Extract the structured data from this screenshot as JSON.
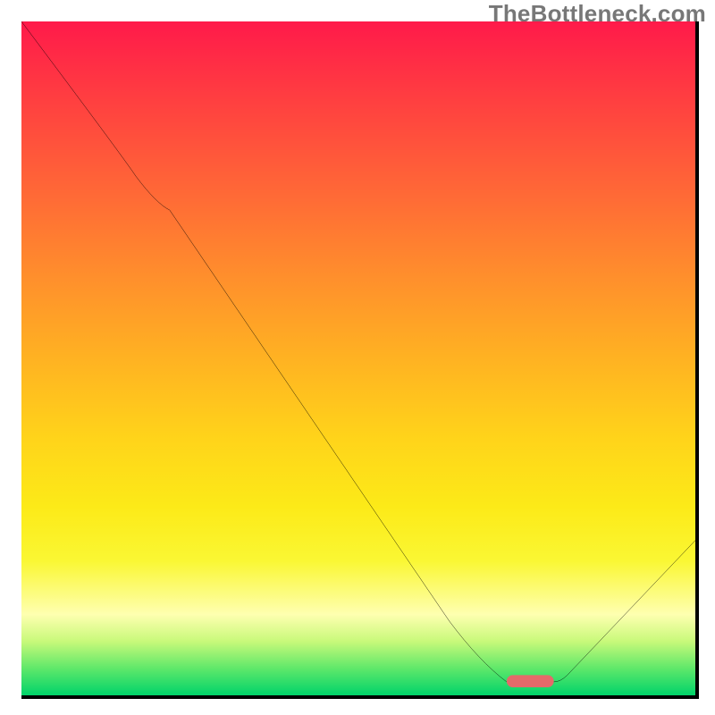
{
  "watermark": "TheBottleneck.com",
  "chart_data": {
    "type": "line",
    "title": "",
    "xlabel": "",
    "ylabel": "",
    "xlim": [
      0,
      100
    ],
    "ylim": [
      0,
      100
    ],
    "grid": false,
    "legend": false,
    "background": "red-yellow-green vertical gradient",
    "series": [
      {
        "name": "curve",
        "x": [
          0,
          17,
          22,
          63.5,
          72,
          79,
          81,
          100
        ],
        "values": [
          100,
          77,
          72,
          11,
          2,
          2,
          3,
          23
        ]
      }
    ],
    "marker": {
      "name": "highlight-bar",
      "x_start": 72,
      "x_end": 79,
      "y": 2,
      "color": "#e46a6a"
    }
  }
}
